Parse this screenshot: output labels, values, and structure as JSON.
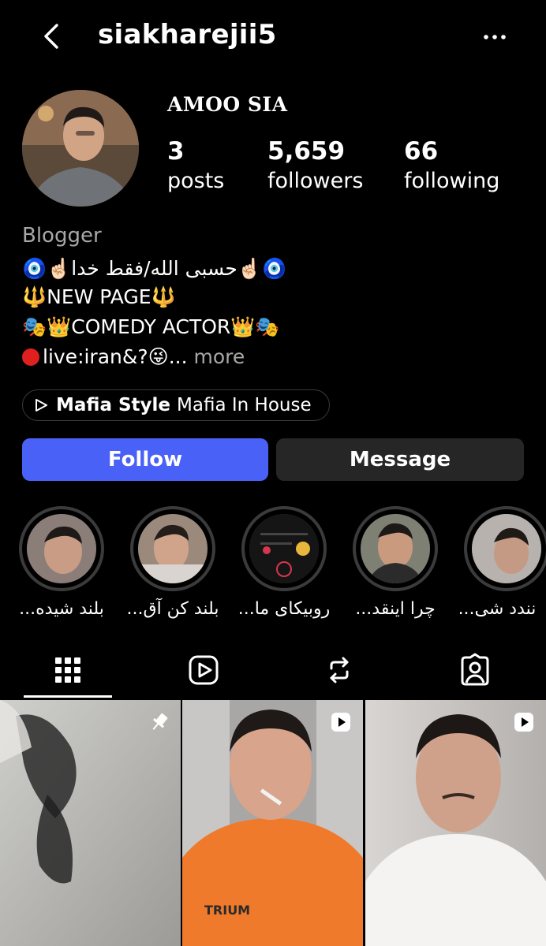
{
  "header": {
    "username": "siakharejii5"
  },
  "profile": {
    "display_name": "AMOO SIA",
    "stats": [
      {
        "value": "3",
        "label": "posts"
      },
      {
        "value": "5,659",
        "label": "followers"
      },
      {
        "value": "66",
        "label": "following"
      }
    ],
    "category": "Blogger",
    "bio_lines": [
      "🧿☝🏻حسبی الله/فقط خدا☝🏻🧿",
      "🔱NEW PAGE🔱",
      "🎭👑COMEDY ACTOR👑🎭",
      "live:iran&?😜..."
    ],
    "bio_more": "more"
  },
  "music": {
    "title": "Mafia Style",
    "artist": "Mafia In House"
  },
  "actions": {
    "follow": "Follow",
    "message": "Message"
  },
  "highlights": [
    {
      "label": "بلند شیده..."
    },
    {
      "label": "بلند کن آق..."
    },
    {
      "label": "روبیکای ما..."
    },
    {
      "label": "چرا اینقد..."
    },
    {
      "label": "نندد شی..."
    }
  ],
  "tabs": [
    {
      "icon": "grid-icon",
      "active": true
    },
    {
      "icon": "reels-icon",
      "active": false
    },
    {
      "icon": "reposts-icon",
      "active": false
    },
    {
      "icon": "tagged-icon",
      "active": false
    }
  ],
  "grid": [
    {
      "badge": "pin-icon"
    },
    {
      "badge": "reel-icon"
    },
    {
      "badge": "reel-icon"
    }
  ],
  "colors": {
    "follow": "#4a61f8",
    "message": "#262626",
    "background": "#000000"
  }
}
